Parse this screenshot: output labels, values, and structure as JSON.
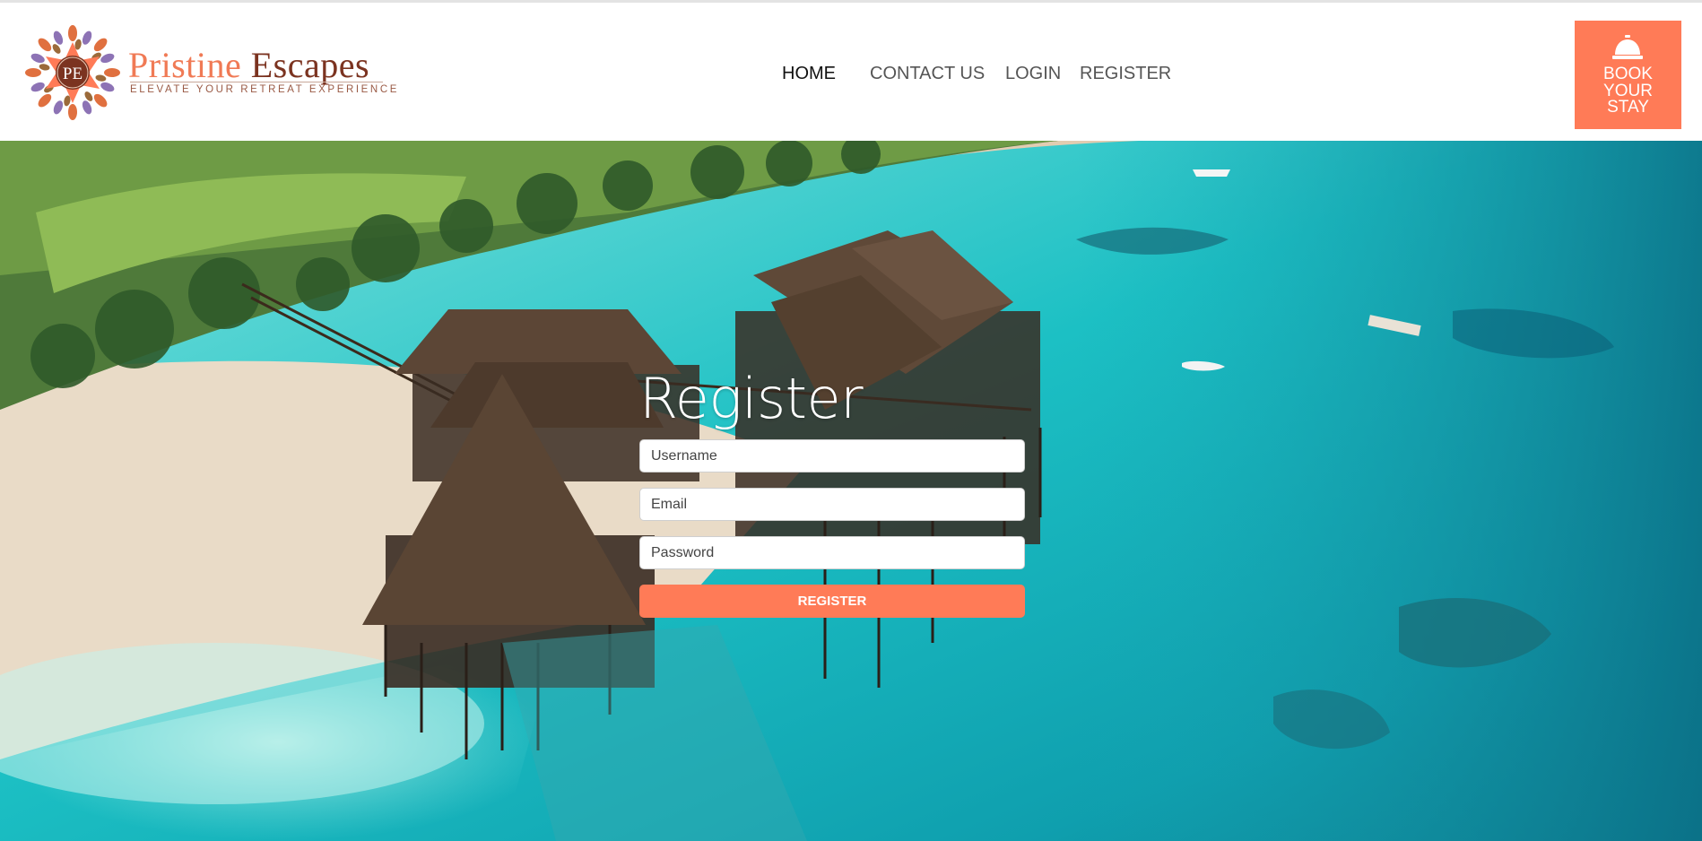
{
  "brand": {
    "monogram": "PE",
    "name_part1": "Pristine",
    "name_part2": "Escapes",
    "tagline": "ELEVATE YOUR RETREAT EXPERIENCE"
  },
  "nav": {
    "items": [
      {
        "label": "HOME",
        "active": true
      },
      {
        "label": "CONTACT US",
        "active": false
      },
      {
        "label": "LOGIN",
        "active": false
      },
      {
        "label": "REGISTER",
        "active": false
      }
    ]
  },
  "book_button": {
    "label": "BOOK\nYOUR\nSTAY",
    "icon": "service-bell-icon"
  },
  "register_form": {
    "title": "Register",
    "username_placeholder": "Username",
    "email_placeholder": "Email",
    "password_placeholder": "Password",
    "submit_label": "REGISTER"
  },
  "colors": {
    "accent": "#ff7b57",
    "brand_orange": "#f07a55",
    "brand_brown": "#7b3320"
  }
}
